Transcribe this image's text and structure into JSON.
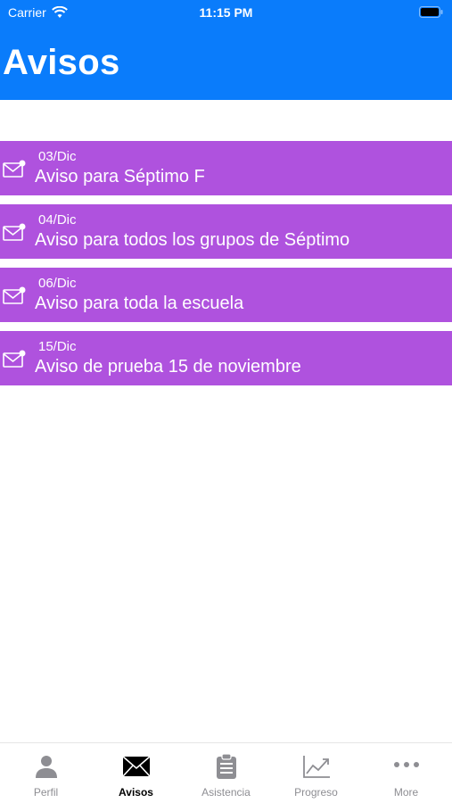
{
  "status_bar": {
    "carrier": "Carrier",
    "time": "11:15 PM"
  },
  "header": {
    "title": "Avisos"
  },
  "notices": [
    {
      "date": "03/Dic",
      "title": "Aviso para Séptimo F",
      "icon": "mail-unread-icon"
    },
    {
      "date": "04/Dic",
      "title": "Aviso para todos los grupos de Séptimo",
      "icon": "mail-unread-icon"
    },
    {
      "date": "06/Dic",
      "title": "Aviso para toda la escuela",
      "icon": "mail-unread-icon"
    },
    {
      "date": "15/Dic",
      "title": "Aviso de prueba 15 de noviembre",
      "icon": "mail-unread-icon"
    }
  ],
  "tabbar": {
    "tabs": [
      {
        "label": "Perfil",
        "icon": "person-icon",
        "active": false
      },
      {
        "label": "Avisos",
        "icon": "envelope-icon",
        "active": true
      },
      {
        "label": "Asistencia",
        "icon": "clipboard-icon",
        "active": false
      },
      {
        "label": "Progreso",
        "icon": "chart-line-icon",
        "active": false
      },
      {
        "label": "More",
        "icon": "more-icon",
        "active": false
      }
    ]
  },
  "colors": {
    "header_bg": "#0a7cfb",
    "row_bg": "#af52de",
    "tab_inactive": "#8e8e93",
    "tab_active": "#000000"
  }
}
